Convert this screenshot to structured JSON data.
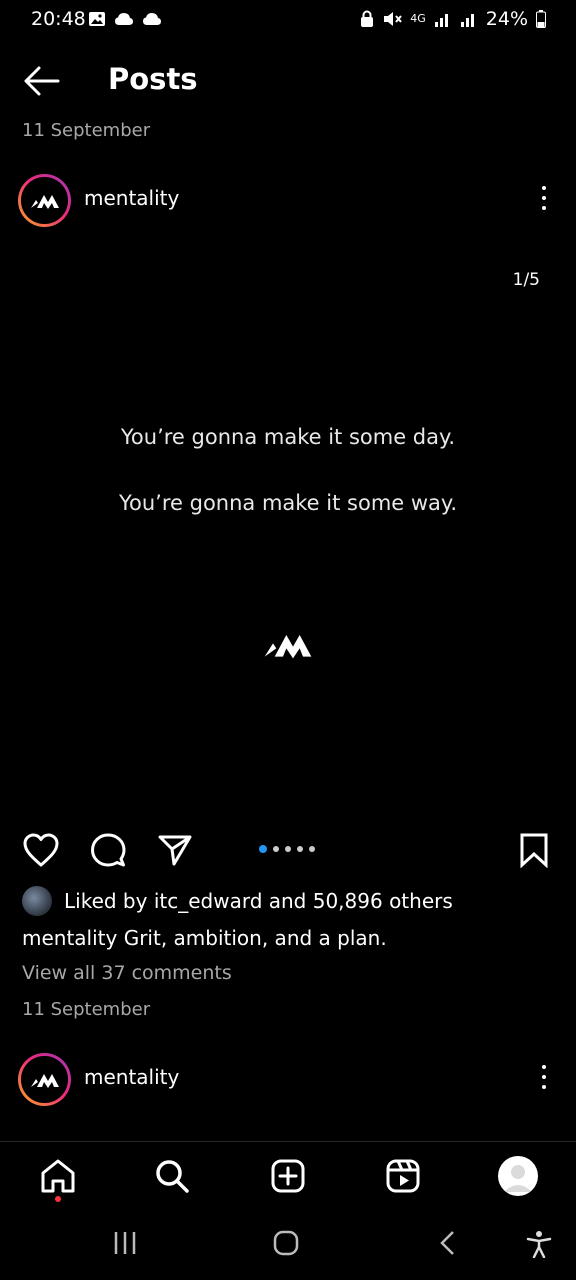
{
  "status_bar": {
    "time": "20:48",
    "network": "4G",
    "battery_percent": "24%"
  },
  "header": {
    "title": "Posts"
  },
  "post1": {
    "date": "11 September",
    "username": "mentality",
    "slide_counter": "1/5",
    "slide_index": 1,
    "slide_total": 5,
    "quote_line1": "You’re gonna make it some day.",
    "quote_line2": "You’re gonna make it some way.",
    "likes_text": "Liked by itc_edward and 50,896 others",
    "caption": "mentality Grit, ambition, and a plan.",
    "view_comments": "View all 37 comments",
    "footer_date": "11 September"
  },
  "post2": {
    "username": "mentality"
  },
  "colors": {
    "background": "#000000",
    "secondary_text": "#a8a8a8",
    "carousel_active": "#2196f3",
    "notification_dot": "#ff3040"
  },
  "icons": {
    "back": "arrow-left-icon",
    "more": "more-vertical-icon",
    "like": "heart-icon",
    "comment": "comment-icon",
    "share": "send-icon",
    "save": "bookmark-icon",
    "home": "home-icon",
    "search": "search-icon",
    "create": "plus-square-icon",
    "reels": "reels-icon",
    "profile": "profile-avatar"
  }
}
